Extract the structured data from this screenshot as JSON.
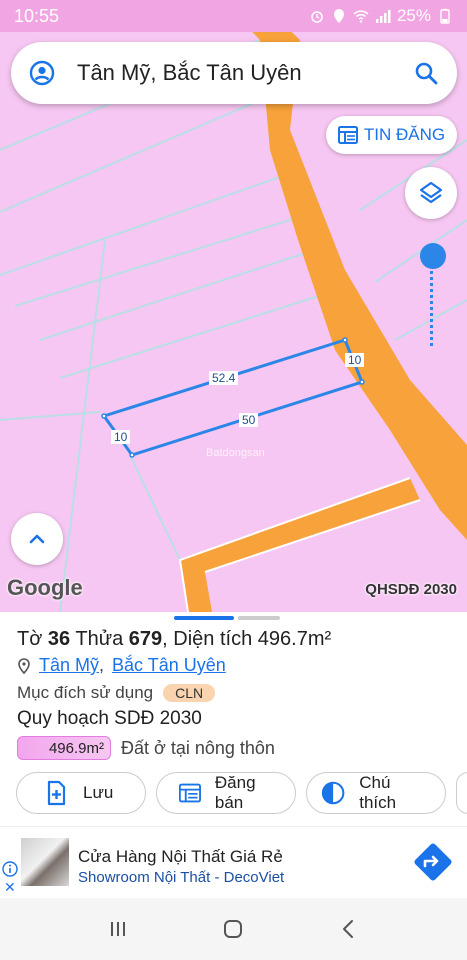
{
  "status_bar": {
    "time": "10:55",
    "battery": "25%"
  },
  "search": {
    "query": "Tân Mỹ, Bắc Tân Uyên"
  },
  "map": {
    "tin_dang_label": "TIN ĐĂNG",
    "brand": "Google",
    "layer_label": "QHSDĐ 2030",
    "watermark": "Batdongsan",
    "dimensions": {
      "top": "52.4",
      "right": "10",
      "bottom": "50",
      "left": "10"
    }
  },
  "parcel": {
    "to_label": "Tờ",
    "to_value": "36",
    "thua_label": "Thửa",
    "thua_value": "679",
    "area_label": "Diện tích",
    "area_value": "496.7m²",
    "ward": "Tân Mỹ",
    "district": "Bắc Tân Uyên",
    "purpose_label": "Mục đích sử dụng",
    "purpose_code": "CLN",
    "plan_title": "Quy hoạch SDĐ 2030",
    "plan_area": "496.9m²",
    "plan_desc": "Đất ở tại nông thôn"
  },
  "actions": [
    {
      "label": "Lưu",
      "icon": "add-bookmark-icon"
    },
    {
      "label": "Đăng bán",
      "icon": "listing-icon"
    },
    {
      "label": "Chú thích",
      "icon": "legend-icon"
    }
  ],
  "ad": {
    "title": "Cửa Hàng Nội Thất Giá Rẻ",
    "subtitle": "Showroom Nội Thất - DecoViet"
  },
  "colors": {
    "map_bg": "#f6c7f2",
    "road": "#f7a23a",
    "accent": "#1a73e8",
    "parcel_line": "#2b86e8"
  }
}
